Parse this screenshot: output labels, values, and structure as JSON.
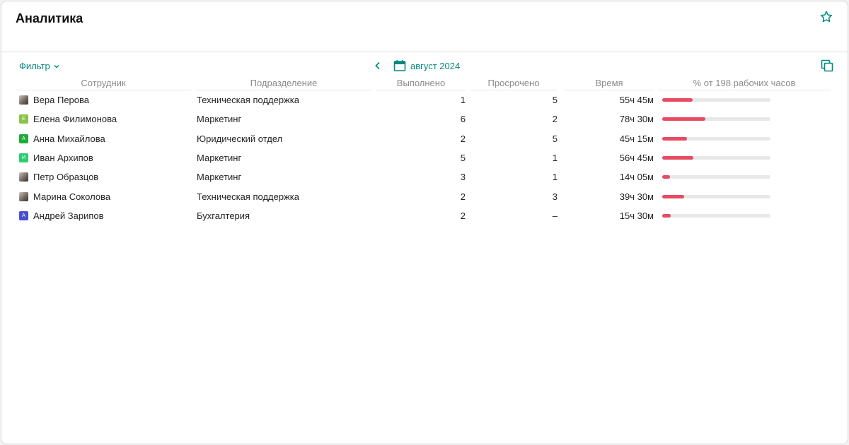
{
  "header": {
    "title": "Аналитика",
    "star_icon": "star-outline-icon"
  },
  "toolbar": {
    "filter_label": "Фильтр",
    "month_label": "август 2024",
    "accent_color": "#00897b"
  },
  "table": {
    "columns": [
      "Сотрудник",
      "Подразделение",
      "Выполнено",
      "Просрочено",
      "Время",
      "% от 198 рабочих часов"
    ],
    "rows": [
      {
        "employee": "Вера Перова",
        "avatar": "photo",
        "avatar_letter": "",
        "avatar_color": "",
        "department": "Техническая поддержка",
        "done": "1",
        "overdue": "5",
        "time": "55ч 45м",
        "load_fraction": 0.28
      },
      {
        "employee": "Елена Филимонова",
        "avatar": "letter",
        "avatar_letter": "Е",
        "avatar_color": "#8bc34a",
        "department": "Маркетинг",
        "done": "6",
        "overdue": "2",
        "time": "78ч 30м",
        "load_fraction": 0.4
      },
      {
        "employee": "Анна Михайлова",
        "avatar": "letter",
        "avatar_letter": "А",
        "avatar_color": "#1faa3c",
        "department": "Юридический отдел",
        "done": "2",
        "overdue": "5",
        "time": "45ч 15м",
        "load_fraction": 0.23
      },
      {
        "employee": "Иван Архипов",
        "avatar": "letter",
        "avatar_letter": "И",
        "avatar_color": "#2ecc71",
        "department": "Маркетинг",
        "done": "5",
        "overdue": "1",
        "time": "56ч 45м",
        "load_fraction": 0.29
      },
      {
        "employee": "Петр Образцов",
        "avatar": "photo",
        "avatar_letter": "",
        "avatar_color": "",
        "department": "Маркетинг",
        "done": "3",
        "overdue": "1",
        "time": "14ч 05м",
        "load_fraction": 0.07
      },
      {
        "employee": "Марина Соколова",
        "avatar": "photo",
        "avatar_letter": "",
        "avatar_color": "",
        "department": "Техническая поддержка",
        "done": "2",
        "overdue": "3",
        "time": "39ч 30м",
        "load_fraction": 0.2
      },
      {
        "employee": "Андрей Зарипов",
        "avatar": "letter",
        "avatar_letter": "А",
        "avatar_color": "#4a4fcf",
        "department": "Бухгалтерия",
        "done": "2",
        "overdue": "–",
        "time": "15ч 30м",
        "load_fraction": 0.08
      }
    ]
  }
}
